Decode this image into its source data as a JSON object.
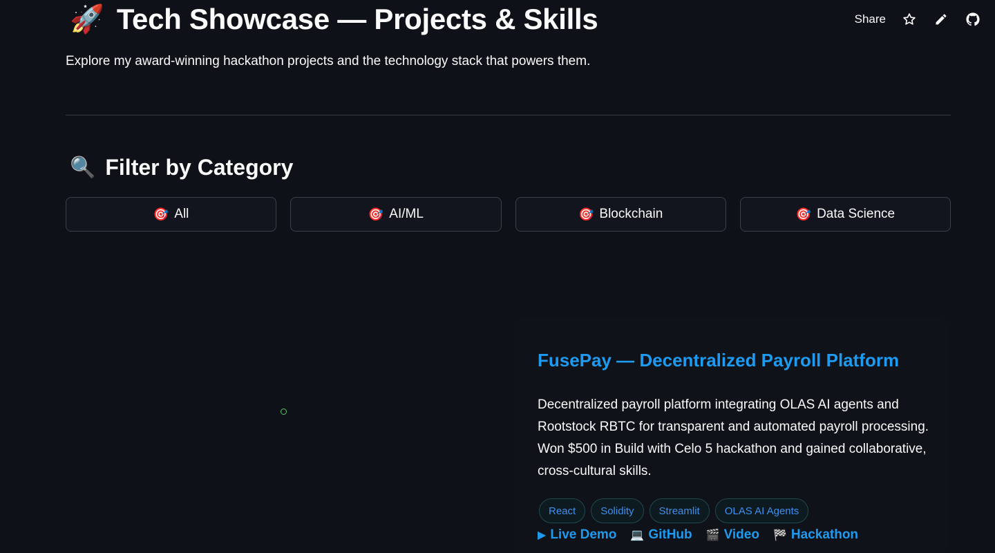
{
  "header": {
    "title_emoji": "🚀",
    "title": "Tech Showcase — Projects & Skills",
    "subtitle": "Explore my award-winning hackathon projects and the technology stack that powers them."
  },
  "toolbar": {
    "share_label": "Share",
    "icons": [
      "star-icon",
      "pencil-icon",
      "github-icon"
    ]
  },
  "filter_section": {
    "emoji": "🔍",
    "title": "Filter by Category",
    "buttons": [
      {
        "emoji": "🎯",
        "label": "All"
      },
      {
        "emoji": "🎯",
        "label": "AI/ML"
      },
      {
        "emoji": "🎯",
        "label": "Blockchain"
      },
      {
        "emoji": "🎯",
        "label": "Data Science"
      }
    ]
  },
  "project": {
    "title": "FusePay — Decentralized Payroll Platform",
    "description": "Decentralized payroll platform integrating OLAS AI agents and Rootstock RBTC for transparent and automated payroll processing. Won $500 in Build with Celo 5 hackathon and gained collaborative, cross-cultural skills.",
    "tags": [
      "React",
      "Solidity",
      "Streamlit",
      "OLAS AI Agents"
    ],
    "links": [
      {
        "emoji": "▶",
        "label": "Live Demo"
      },
      {
        "emoji": "💻",
        "label": "GitHub"
      },
      {
        "emoji": "🎬",
        "label": "Video"
      },
      {
        "emoji": "🏁",
        "label": "Hackathon"
      }
    ]
  },
  "colors": {
    "background": "#0e1117",
    "accent": "#1e9bf0",
    "tag_text": "#3d8ff0",
    "spinner": "#5ec46a"
  }
}
